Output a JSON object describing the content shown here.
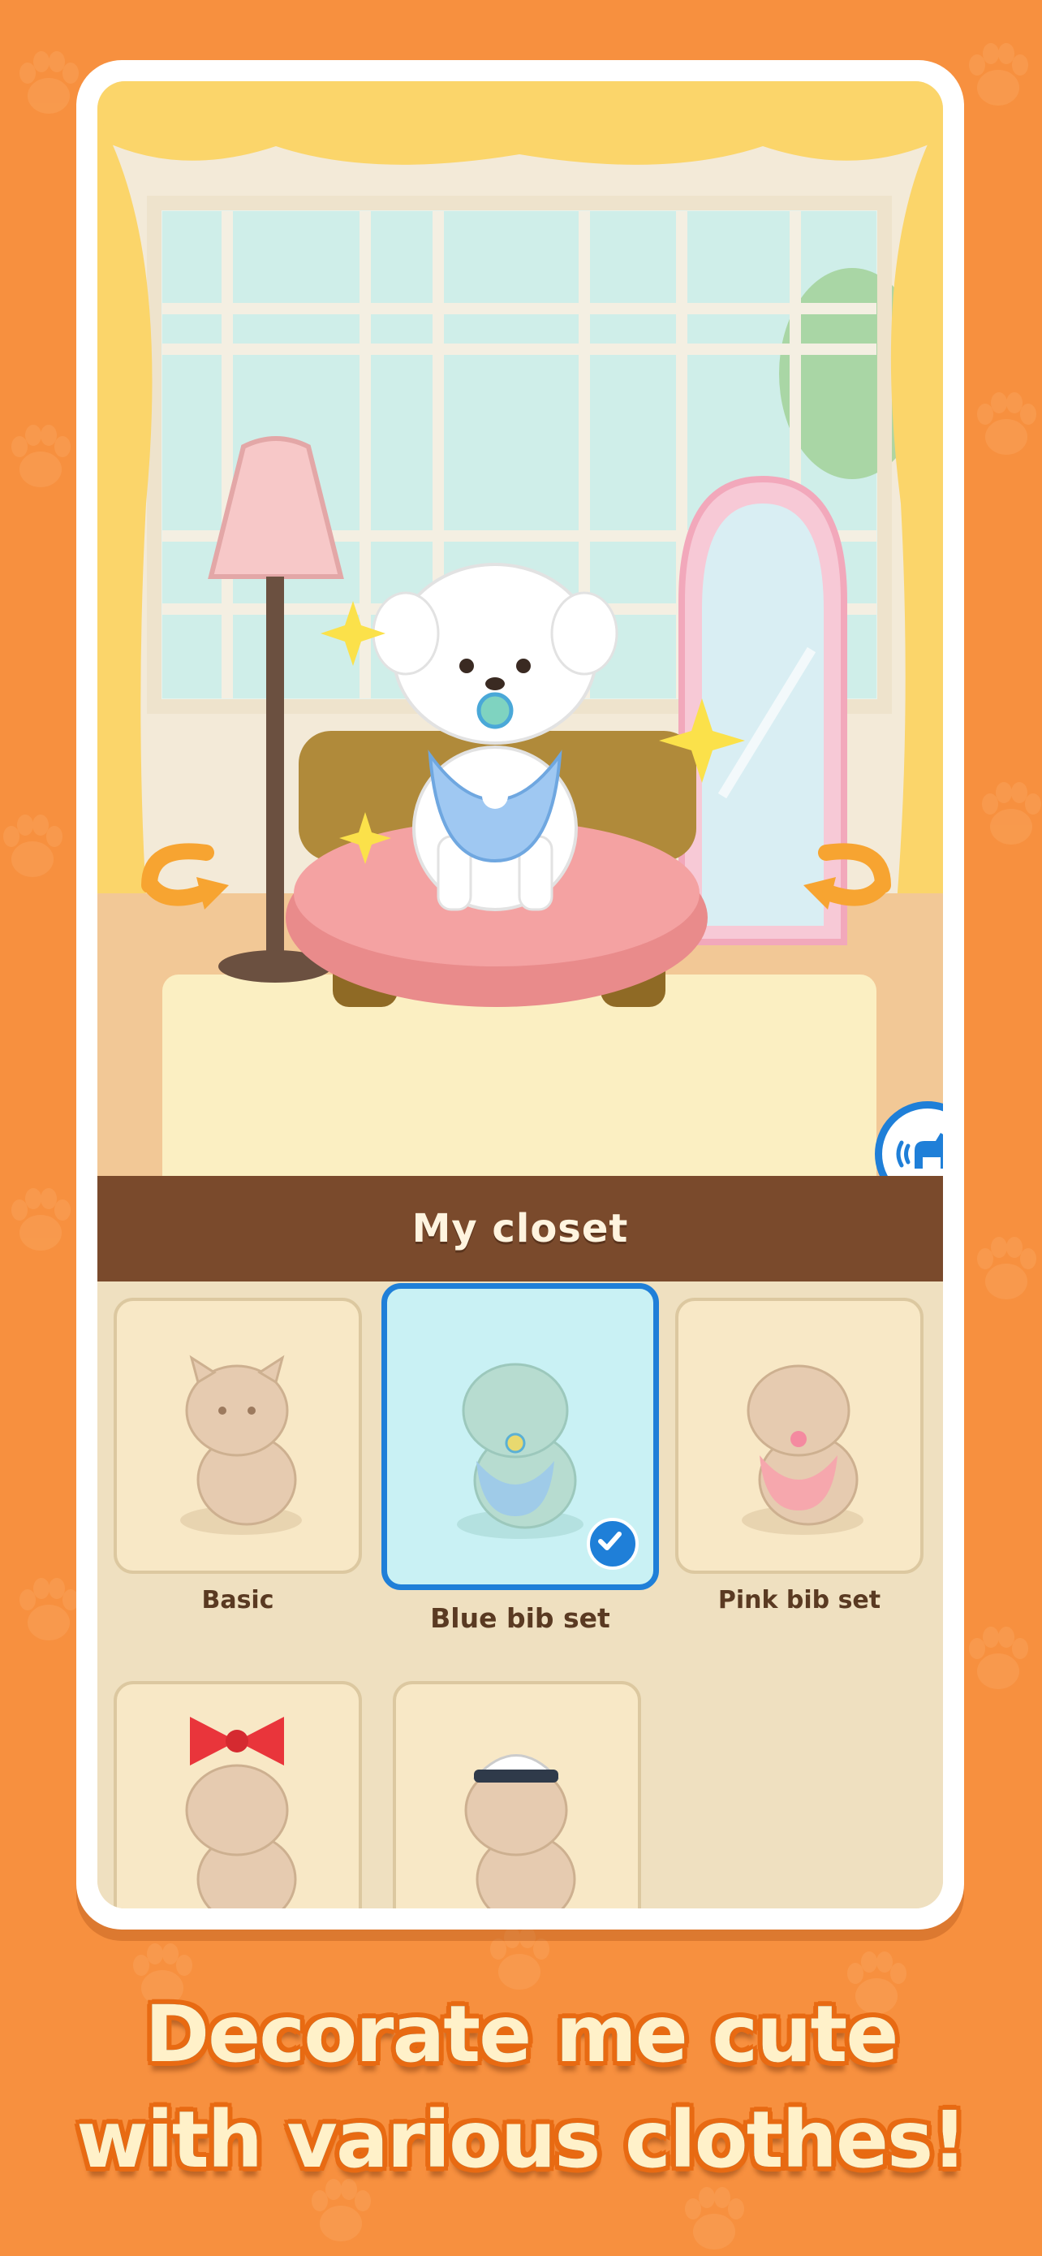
{
  "closet": {
    "title": "My closet",
    "items": [
      {
        "label": "Basic",
        "selected": false,
        "accessory": "none"
      },
      {
        "label": "Blue bib set",
        "selected": true,
        "accessory": "blue-bib"
      },
      {
        "label": "Pink bib set",
        "selected": false,
        "accessory": "pink-bib"
      },
      {
        "label": "",
        "selected": false,
        "accessory": "red-polka-bow"
      },
      {
        "label": "",
        "selected": false,
        "accessory": "sailor-cap"
      }
    ]
  },
  "tagline": {
    "line1": "Decorate me cute",
    "line2": "with various clothes!"
  },
  "colors": {
    "background": "#f7903f",
    "accent_blue": "#1f7fd8",
    "closet_bar": "#7a4a2c",
    "tagline_fill": "#fff1c9",
    "tagline_outline": "#e86a12"
  },
  "icons": {
    "sound": "dog-sound-icon",
    "left_arrow": "curved-arrow-left-icon",
    "right_arrow": "curved-arrow-right-icon",
    "check": "check-icon"
  }
}
